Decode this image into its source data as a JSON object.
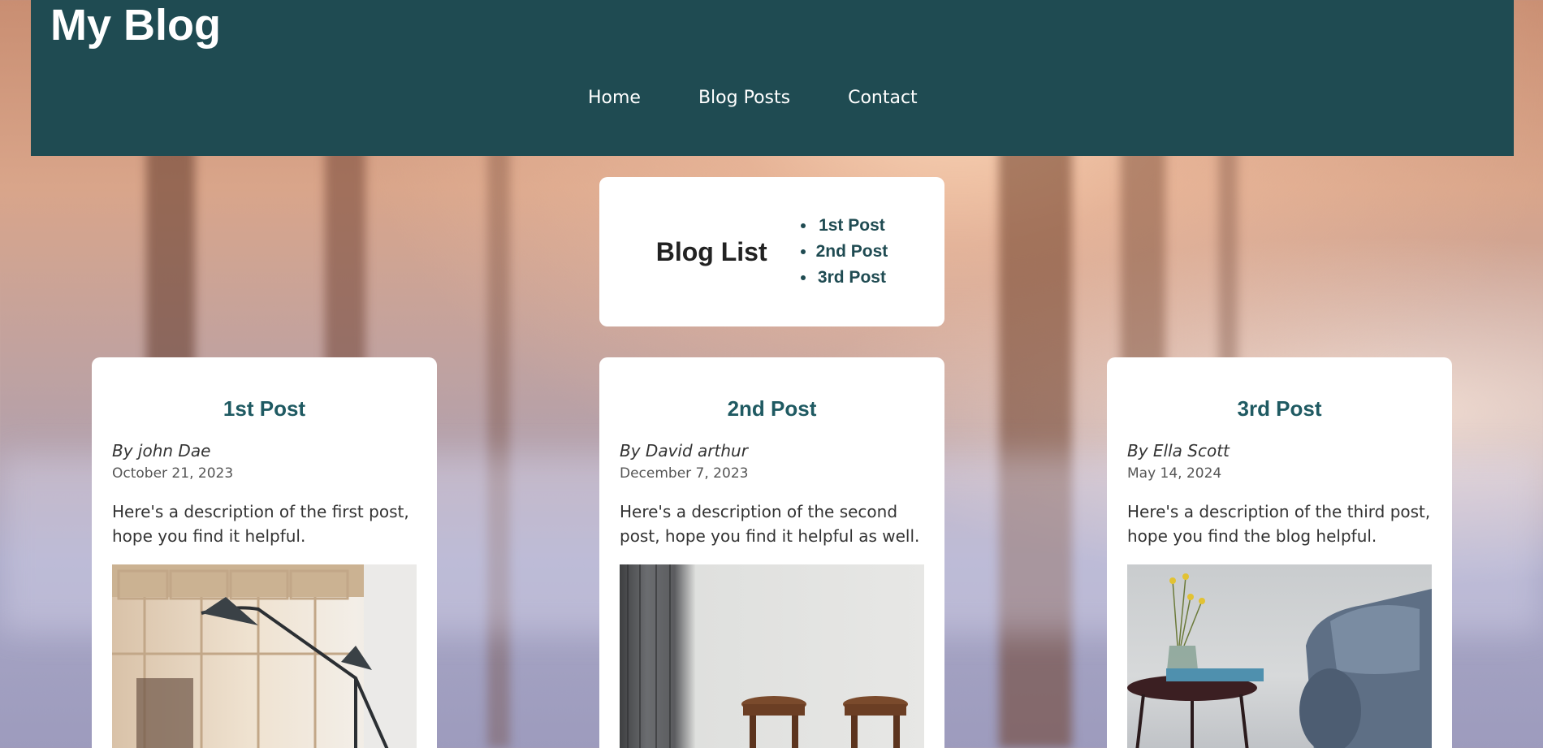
{
  "header": {
    "site_title": "My Blog",
    "nav": [
      "Home",
      "Blog Posts",
      "Contact"
    ],
    "background_color": "#1f4b52"
  },
  "blog_list": {
    "title": "Blog List",
    "items": [
      "1st Post",
      "2nd Post",
      "3rd Post"
    ]
  },
  "posts": [
    {
      "title": "1st Post",
      "author": "By john Dae",
      "date": "October 21, 2023",
      "description": "Here's a description of the first post, hope you find it helpful.",
      "image": "floor-lamp-photo"
    },
    {
      "title": "2nd Post",
      "author": "By David arthur",
      "date": "December 7, 2023",
      "description": "Here's a description of the second post, hope you find it helpful as well.",
      "image": "wooden-stools-photo"
    },
    {
      "title": "3rd Post",
      "author": "By Ella Scott",
      "date": "May 14, 2024",
      "description": "Here's a description of the third post, hope you find the blog helpful.",
      "image": "armchair-side-table-photo"
    }
  ]
}
